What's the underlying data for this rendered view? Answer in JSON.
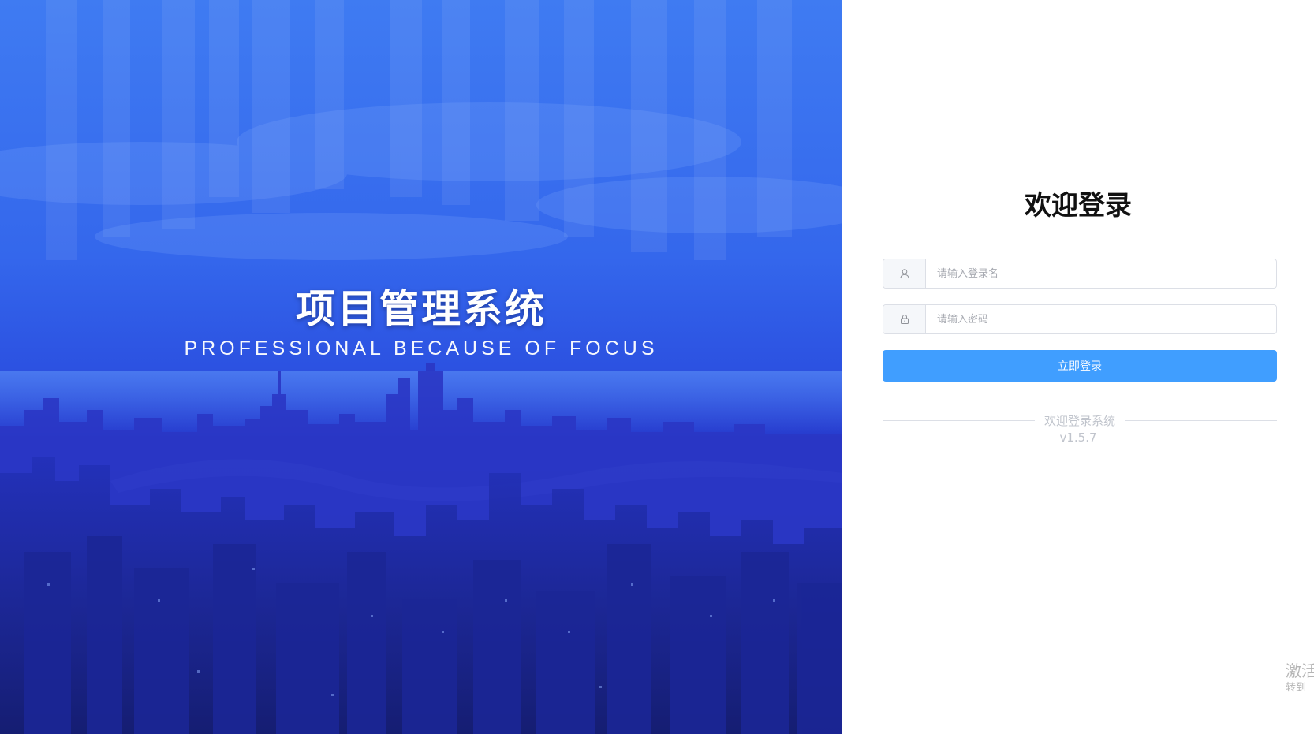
{
  "hero": {
    "title": "项目管理系统",
    "subtitle": "PROFESSIONAL BECAUSE OF FOCUS"
  },
  "login": {
    "title": "欢迎登录",
    "username_placeholder": "请输入登录名",
    "username_icon": "user-icon",
    "password_placeholder": "请输入密码",
    "password_icon": "lock-icon",
    "submit_label": "立即登录",
    "divider_text": "欢迎登录系统",
    "version": "v1.5.7"
  },
  "watermark": {
    "line1": "激活",
    "line2": "转到"
  },
  "colors": {
    "accent": "#409eff",
    "hero_blue": "#2540d2"
  }
}
